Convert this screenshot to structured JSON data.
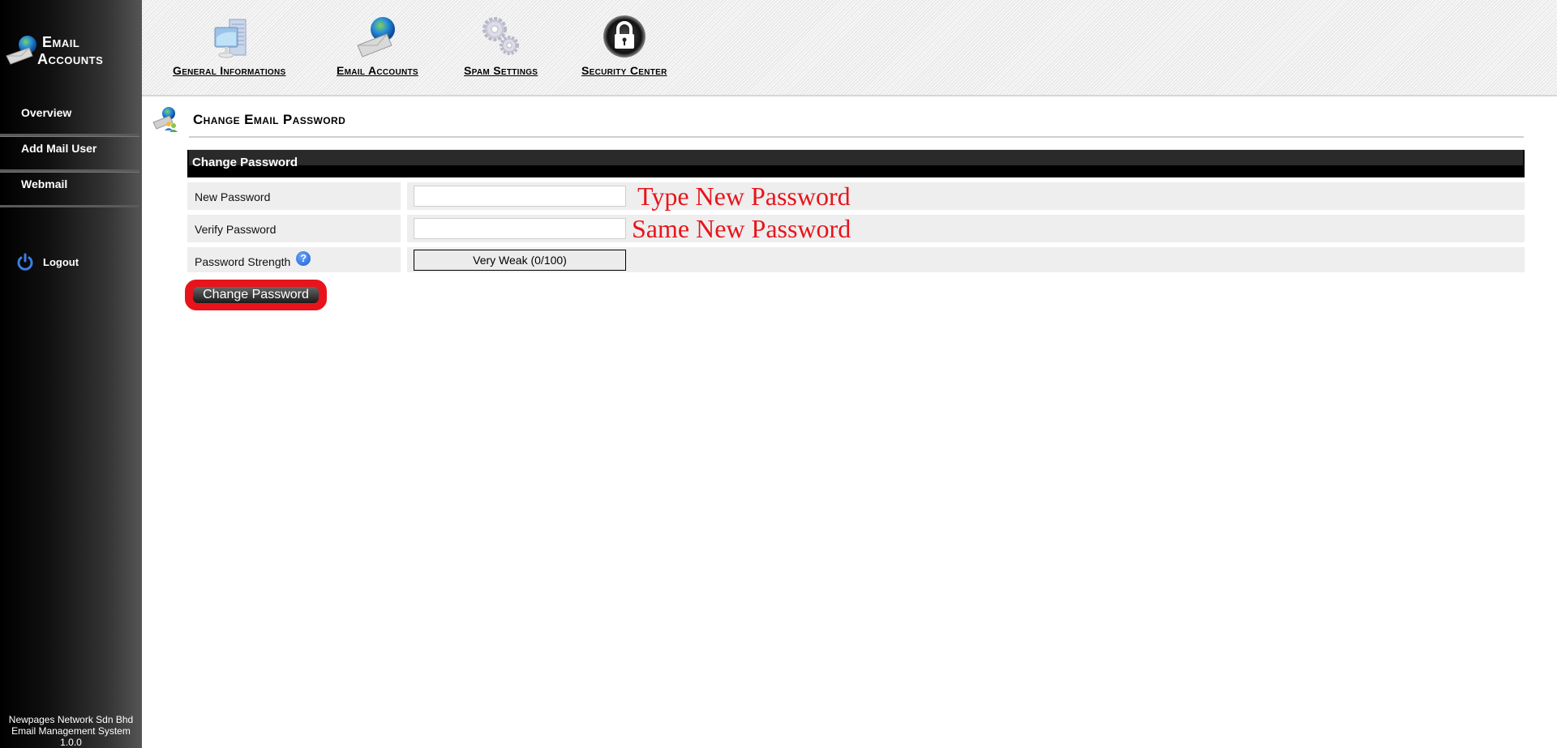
{
  "sidebar": {
    "brand": {
      "line1": "Email",
      "line2": "Accounts",
      "icon": "email-globe-icon"
    },
    "items": [
      {
        "label": "Overview"
      },
      {
        "label": "Add Mail User"
      },
      {
        "label": "Webmail"
      }
    ],
    "logout": {
      "label": "Logout",
      "icon": "power-icon"
    },
    "footer": {
      "line1": "Newpages Network Sdn Bhd",
      "line2": "Email Management System",
      "line3": "1.0.0"
    }
  },
  "topnav": {
    "items": [
      {
        "label": "General Informations",
        "icon": "computer-icon"
      },
      {
        "label": "Email Accounts",
        "icon": "email-globe-icon"
      },
      {
        "label": "Spam Settings",
        "icon": "gears-icon"
      },
      {
        "label": "Security Center",
        "icon": "lock-icon"
      }
    ]
  },
  "page": {
    "title": "Change Email Password",
    "icon": "email-users-icon"
  },
  "form": {
    "header": "Change Password",
    "new_password": {
      "label": "New Password",
      "value": "",
      "placeholder": "",
      "annotation": "Type New Password"
    },
    "verify_password": {
      "label": "Verify Password",
      "value": "",
      "placeholder": "",
      "annotation": "Same New Password"
    },
    "strength": {
      "label": "Password Strength",
      "help_icon": "help-icon",
      "text": "Very Weak (0/100)",
      "score": 0,
      "max": 100
    },
    "submit_label": "Change Password"
  },
  "colors": {
    "annotation": "#e8141c",
    "header_bar": "#000000",
    "row_bg": "#eeeeee"
  }
}
